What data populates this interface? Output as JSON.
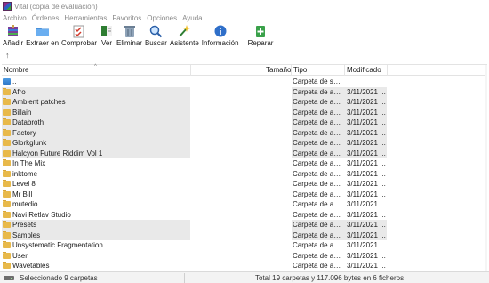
{
  "window": {
    "title": "Vital (copia de evaluación)"
  },
  "menu": [
    "Archivo",
    "Órdenes",
    "Herramientas",
    "Favoritos",
    "Opciones",
    "Ayuda"
  ],
  "toolbar": [
    {
      "label": "Añadir",
      "icon": "add-archive-icon"
    },
    {
      "label": "Extraer en",
      "icon": "extract-folder-icon"
    },
    {
      "label": "Comprobar",
      "icon": "test-checklist-icon"
    },
    {
      "label": "Ver",
      "icon": "view-book-icon"
    },
    {
      "label": "Eliminar",
      "icon": "trash-icon"
    },
    {
      "label": "Buscar",
      "icon": "search-icon"
    },
    {
      "label": "Asistente",
      "icon": "wizard-icon"
    },
    {
      "label": "Información",
      "icon": "info-icon"
    },
    {
      "label": "Reparar",
      "icon": "repair-kit-icon"
    }
  ],
  "columns": {
    "name": "Nombre",
    "size": "Tamaño",
    "type": "Tipo",
    "modified": "Modificado"
  },
  "rows": [
    {
      "name": "..",
      "type": "Carpeta de sist...",
      "modified": "",
      "icon": "drive",
      "shaded": false
    },
    {
      "name": "Afro",
      "type": "Carpeta de arc...",
      "modified": "3/11/2021 ...",
      "icon": "folder",
      "shaded": true
    },
    {
      "name": "Ambient patches",
      "type": "Carpeta de arc...",
      "modified": "3/11/2021 ...",
      "icon": "folder",
      "shaded": true
    },
    {
      "name": "Billain",
      "type": "Carpeta de arc...",
      "modified": "3/11/2021 ...",
      "icon": "folder",
      "shaded": true
    },
    {
      "name": "Databroth",
      "type": "Carpeta de arc...",
      "modified": "3/11/2021 ...",
      "icon": "folder",
      "shaded": true
    },
    {
      "name": "Factory",
      "type": "Carpeta de arc...",
      "modified": "3/11/2021 ...",
      "icon": "folder",
      "shaded": true
    },
    {
      "name": "Glorkglunk",
      "type": "Carpeta de arc...",
      "modified": "3/11/2021 ...",
      "icon": "folder",
      "shaded": true
    },
    {
      "name": "Halcyon Future Riddim Vol 1",
      "type": "Carpeta de arc...",
      "modified": "3/11/2021 ...",
      "icon": "folder",
      "shaded": true
    },
    {
      "name": "In The Mix",
      "type": "Carpeta de arc...",
      "modified": "3/11/2021 ...",
      "icon": "folder",
      "shaded": false
    },
    {
      "name": "inktome",
      "type": "Carpeta de arc...",
      "modified": "3/11/2021 ...",
      "icon": "folder",
      "shaded": false
    },
    {
      "name": "Level 8",
      "type": "Carpeta de arc...",
      "modified": "3/11/2021 ...",
      "icon": "folder",
      "shaded": false
    },
    {
      "name": "Mr Bill",
      "type": "Carpeta de arc...",
      "modified": "3/11/2021 ...",
      "icon": "folder",
      "shaded": false
    },
    {
      "name": "mutedio",
      "type": "Carpeta de arc...",
      "modified": "3/11/2021 ...",
      "icon": "folder",
      "shaded": false
    },
    {
      "name": "Navi Retlav Studio",
      "type": "Carpeta de arc...",
      "modified": "3/11/2021 ...",
      "icon": "folder",
      "shaded": false
    },
    {
      "name": "Presets",
      "type": "Carpeta de arc...",
      "modified": "3/11/2021 ...",
      "icon": "folder",
      "shaded": true
    },
    {
      "name": "Samples",
      "type": "Carpeta de arc...",
      "modified": "3/11/2021 ...",
      "icon": "folder",
      "shaded": true
    },
    {
      "name": "Unsystematic Fragmentation",
      "type": "Carpeta de arc...",
      "modified": "3/11/2021 ...",
      "icon": "folder",
      "shaded": false
    },
    {
      "name": "User",
      "type": "Carpeta de arc...",
      "modified": "3/11/2021 ...",
      "icon": "folder",
      "shaded": false
    },
    {
      "name": "Wavetables",
      "type": "Carpeta de arc...",
      "modified": "3/11/2021 ...",
      "icon": "folder",
      "shaded": false
    }
  ],
  "status": {
    "left": "Seleccionado 9 carpetas",
    "right": "Total 19 carpetas y 117.096 bytes en 6 ficheros"
  },
  "colors": {
    "folder": "#e8b94a",
    "selection": "#e9e9e9",
    "statusbar": "#f3f3f3"
  }
}
